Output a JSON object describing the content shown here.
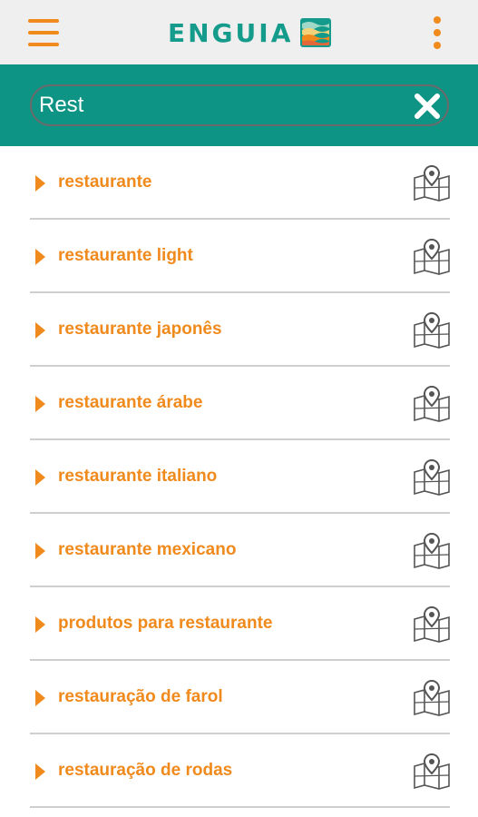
{
  "header": {
    "menu_icon": "hamburger-menu-icon",
    "logo_text": "ENGUIA",
    "logo_icon": "waves-icon",
    "more_icon": "kebab-menu-icon"
  },
  "search": {
    "value": "Rest",
    "clear_icon": "close-icon"
  },
  "results": [
    {
      "label": "restaurante",
      "icon": "map-pin-icon"
    },
    {
      "label": "restaurante light",
      "icon": "map-pin-icon"
    },
    {
      "label": "restaurante japonês",
      "icon": "map-pin-icon"
    },
    {
      "label": "restaurante árabe",
      "icon": "map-pin-icon"
    },
    {
      "label": "restaurante italiano",
      "icon": "map-pin-icon"
    },
    {
      "label": "restaurante mexicano",
      "icon": "map-pin-icon"
    },
    {
      "label": "produtos para restaurante",
      "icon": "map-pin-icon"
    },
    {
      "label": "restauração de farol",
      "icon": "map-pin-icon"
    },
    {
      "label": "restauração de rodas",
      "icon": "map-pin-icon"
    }
  ],
  "colors": {
    "accent": "#f08a1c",
    "brand": "#159b8b",
    "search_bar": "#0e9484",
    "header_bg": "#efefef"
  }
}
